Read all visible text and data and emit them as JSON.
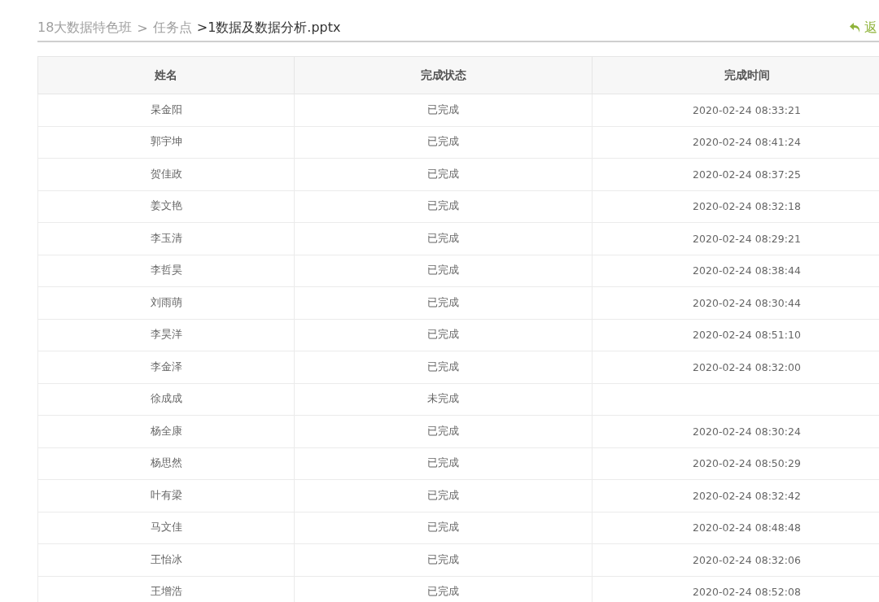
{
  "breadcrumb": [
    {
      "label": "18大数据特色班",
      "current": false,
      "separator": ">"
    },
    {
      "label": "任务点",
      "current": false
    },
    {
      "label": ">1数据及数据分析.pptx",
      "current": true
    }
  ],
  "back_link": {
    "label": "返"
  },
  "table": {
    "columns": [
      "姓名",
      "完成状态",
      "完成时间"
    ],
    "rows": [
      {
        "name": "杲金阳",
        "status": "已完成",
        "time": "2020-02-24 08:33:21"
      },
      {
        "name": "郭宇坤",
        "status": "已完成",
        "time": "2020-02-24 08:41:24"
      },
      {
        "name": "贺佳政",
        "status": "已完成",
        "time": "2020-02-24 08:37:25"
      },
      {
        "name": "姜文艳",
        "status": "已完成",
        "time": "2020-02-24 08:32:18"
      },
      {
        "name": "李玉清",
        "status": "已完成",
        "time": "2020-02-24 08:29:21"
      },
      {
        "name": "李哲昊",
        "status": "已完成",
        "time": "2020-02-24 08:38:44"
      },
      {
        "name": "刘雨萌",
        "status": "已完成",
        "time": "2020-02-24 08:30:44"
      },
      {
        "name": "李昊洋",
        "status": "已完成",
        "time": "2020-02-24 08:51:10"
      },
      {
        "name": "李金泽",
        "status": "已完成",
        "time": "2020-02-24 08:32:00"
      },
      {
        "name": "徐成成",
        "status": "未完成"
      },
      {
        "name": "杨全康",
        "status": "已完成",
        "time": "2020-02-24 08:30:24"
      },
      {
        "name": "杨思然",
        "status": "已完成",
        "time": "2020-02-24 08:50:29"
      },
      {
        "name": "叶有梁",
        "status": "已完成",
        "time": "2020-02-24 08:32:42"
      },
      {
        "name": "马文佳",
        "status": "已完成",
        "time": "2020-02-24 08:48:48"
      },
      {
        "name": "王怡冰",
        "status": "已完成",
        "time": "2020-02-24 08:32:06"
      },
      {
        "name": "王增浩",
        "status": "已完成",
        "time": "2020-02-24 08:52:08"
      }
    ]
  }
}
